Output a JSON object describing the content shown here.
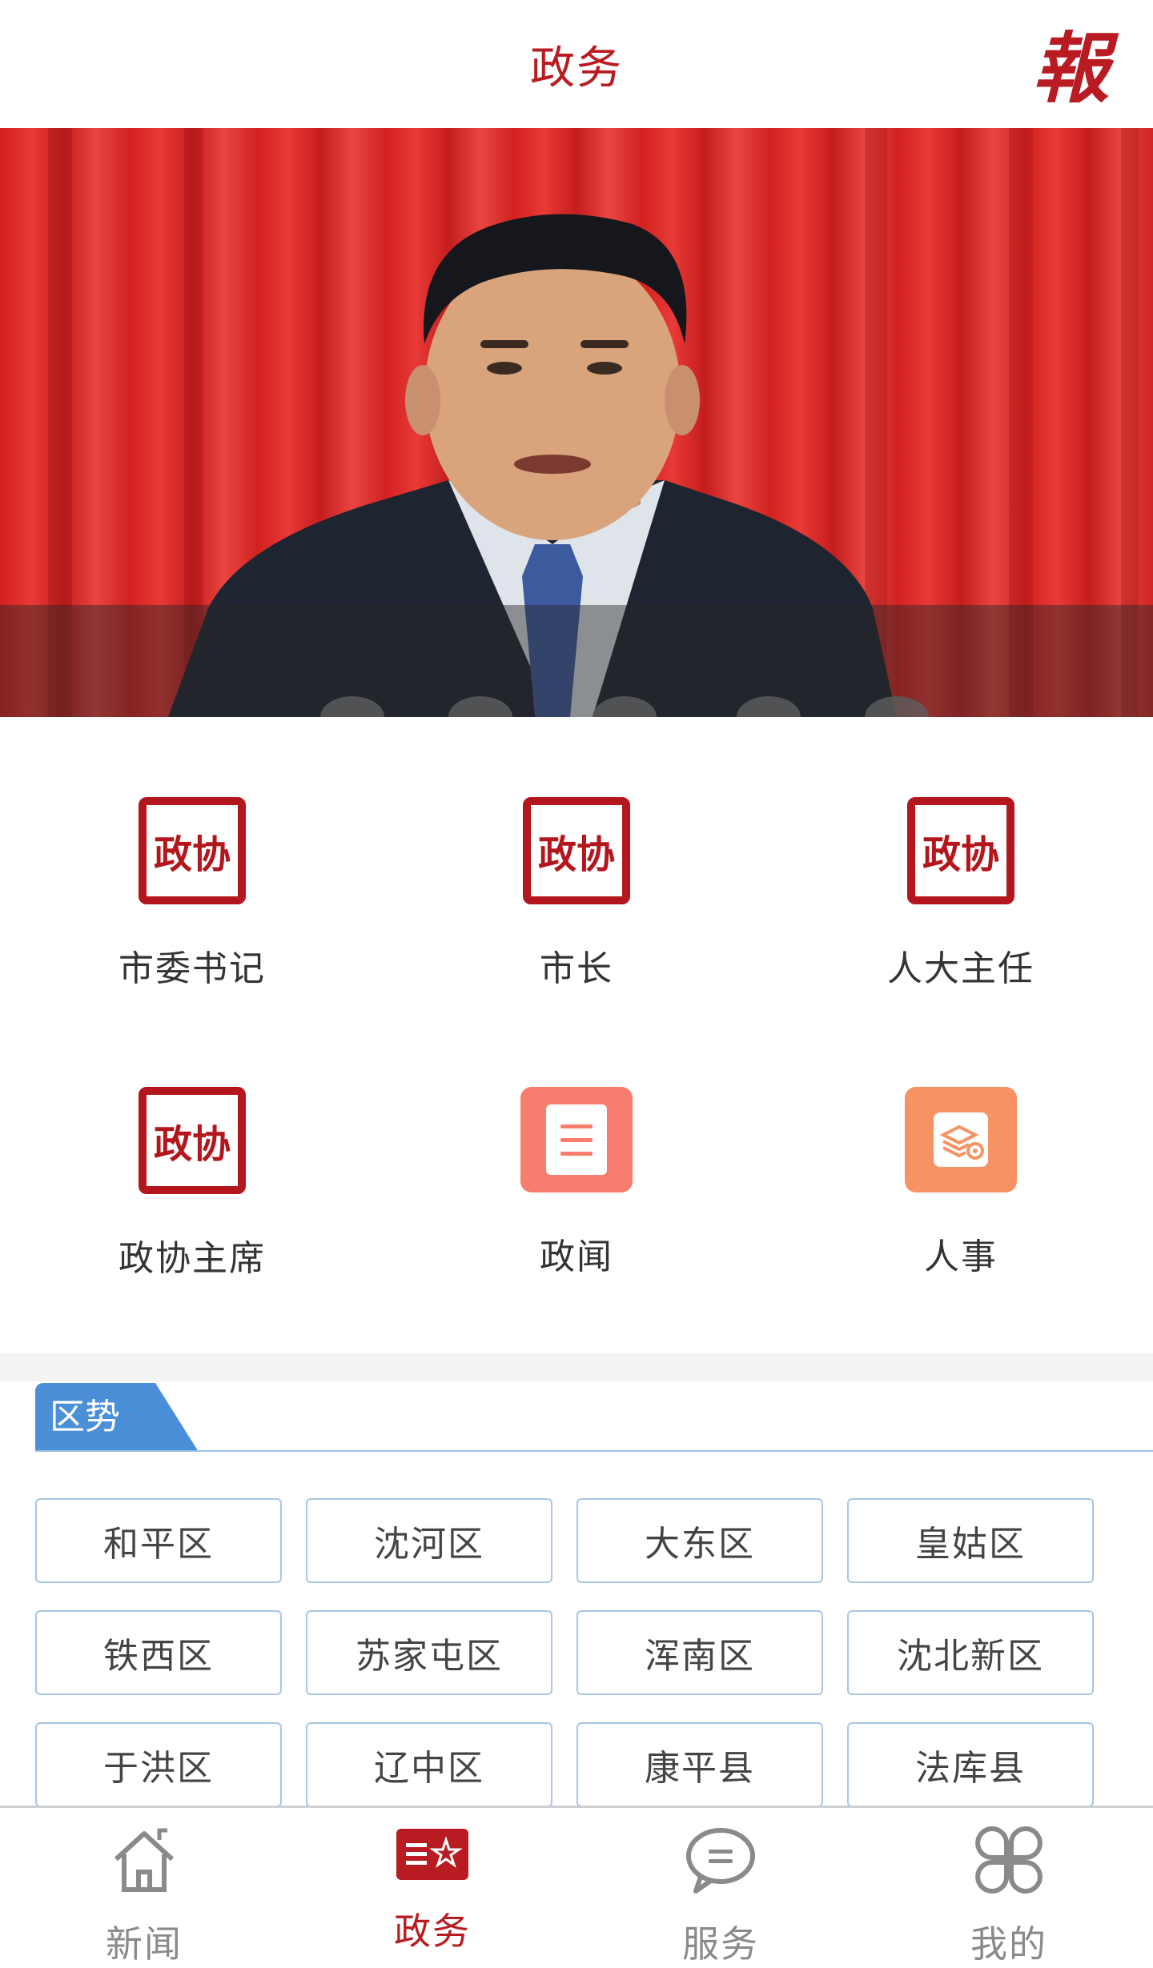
{
  "header": {
    "title": "政务",
    "logo_glyph": "報",
    "accent_color": "#b81c22"
  },
  "banner": {
    "image": "speaker-at-podium-photo"
  },
  "shortcuts": [
    {
      "label": "市委书记",
      "icon": "seal-icon"
    },
    {
      "label": "市长",
      "icon": "seal-icon"
    },
    {
      "label": "人大主任",
      "icon": "seal-icon"
    },
    {
      "label": "政协主席",
      "icon": "seal-icon"
    },
    {
      "label": "政闻",
      "icon": "document-icon"
    },
    {
      "label": "人事",
      "icon": "personnel-icon"
    }
  ],
  "seal_glyph": "政协",
  "district_section": {
    "title": "区势",
    "districts": [
      "和平区",
      "沈河区",
      "大东区",
      "皇姑区",
      "铁西区",
      "苏家屯区",
      "浑南区",
      "沈北新区",
      "于洪区",
      "辽中区",
      "康平县",
      "法库县"
    ]
  },
  "bottom_nav": {
    "items": [
      {
        "label": "新闻",
        "icon": "home-icon",
        "active": false
      },
      {
        "label": "政务",
        "icon": "gov-affairs-icon",
        "active": true
      },
      {
        "label": "服务",
        "icon": "chat-icon",
        "active": false
      },
      {
        "label": "我的",
        "icon": "clover-icon",
        "active": false
      }
    ]
  }
}
